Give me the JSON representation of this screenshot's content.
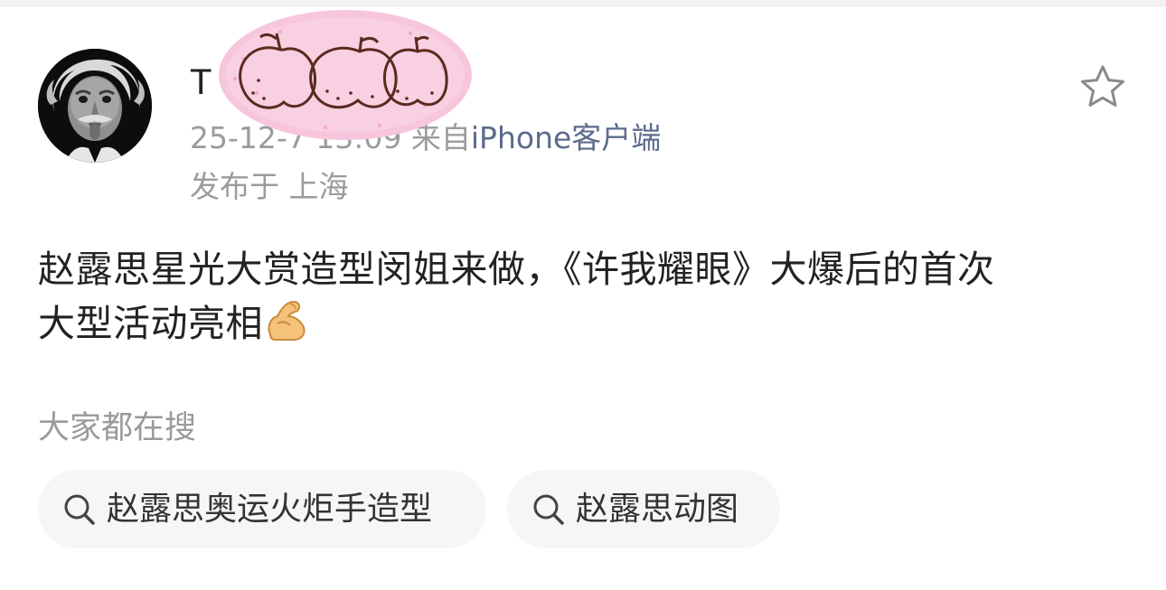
{
  "post": {
    "author": {
      "name_visible": "T",
      "avatar_icon": "einstein-tongue-avatar"
    },
    "meta": {
      "timestamp_partial": "25-12-7 13:09",
      "source_prefix": "来自",
      "source_client": "iPhone客户端"
    },
    "location": "发布于 上海",
    "text_line1": "赵露思星光大赏造型闵姐来做，《许我耀眼》大爆后的首次",
    "text_line2": "大型活动亮相",
    "emoji": "flexed-biceps",
    "star_icon": "star-outline-icon"
  },
  "search_section": {
    "label": "大家都在搜",
    "chips": [
      {
        "label": "赵露思奥运火炬手造型",
        "icon": "search-icon"
      },
      {
        "label": "赵露思动图",
        "icon": "search-icon"
      }
    ]
  },
  "colors": {
    "text_primary": "#222222",
    "text_secondary": "#9b9b9b",
    "source_link": "#5b6b8c",
    "chip_bg": "#f6f6f6",
    "censor_pink": "#f7c6dc",
    "censor_line": "#5a2a1e"
  }
}
